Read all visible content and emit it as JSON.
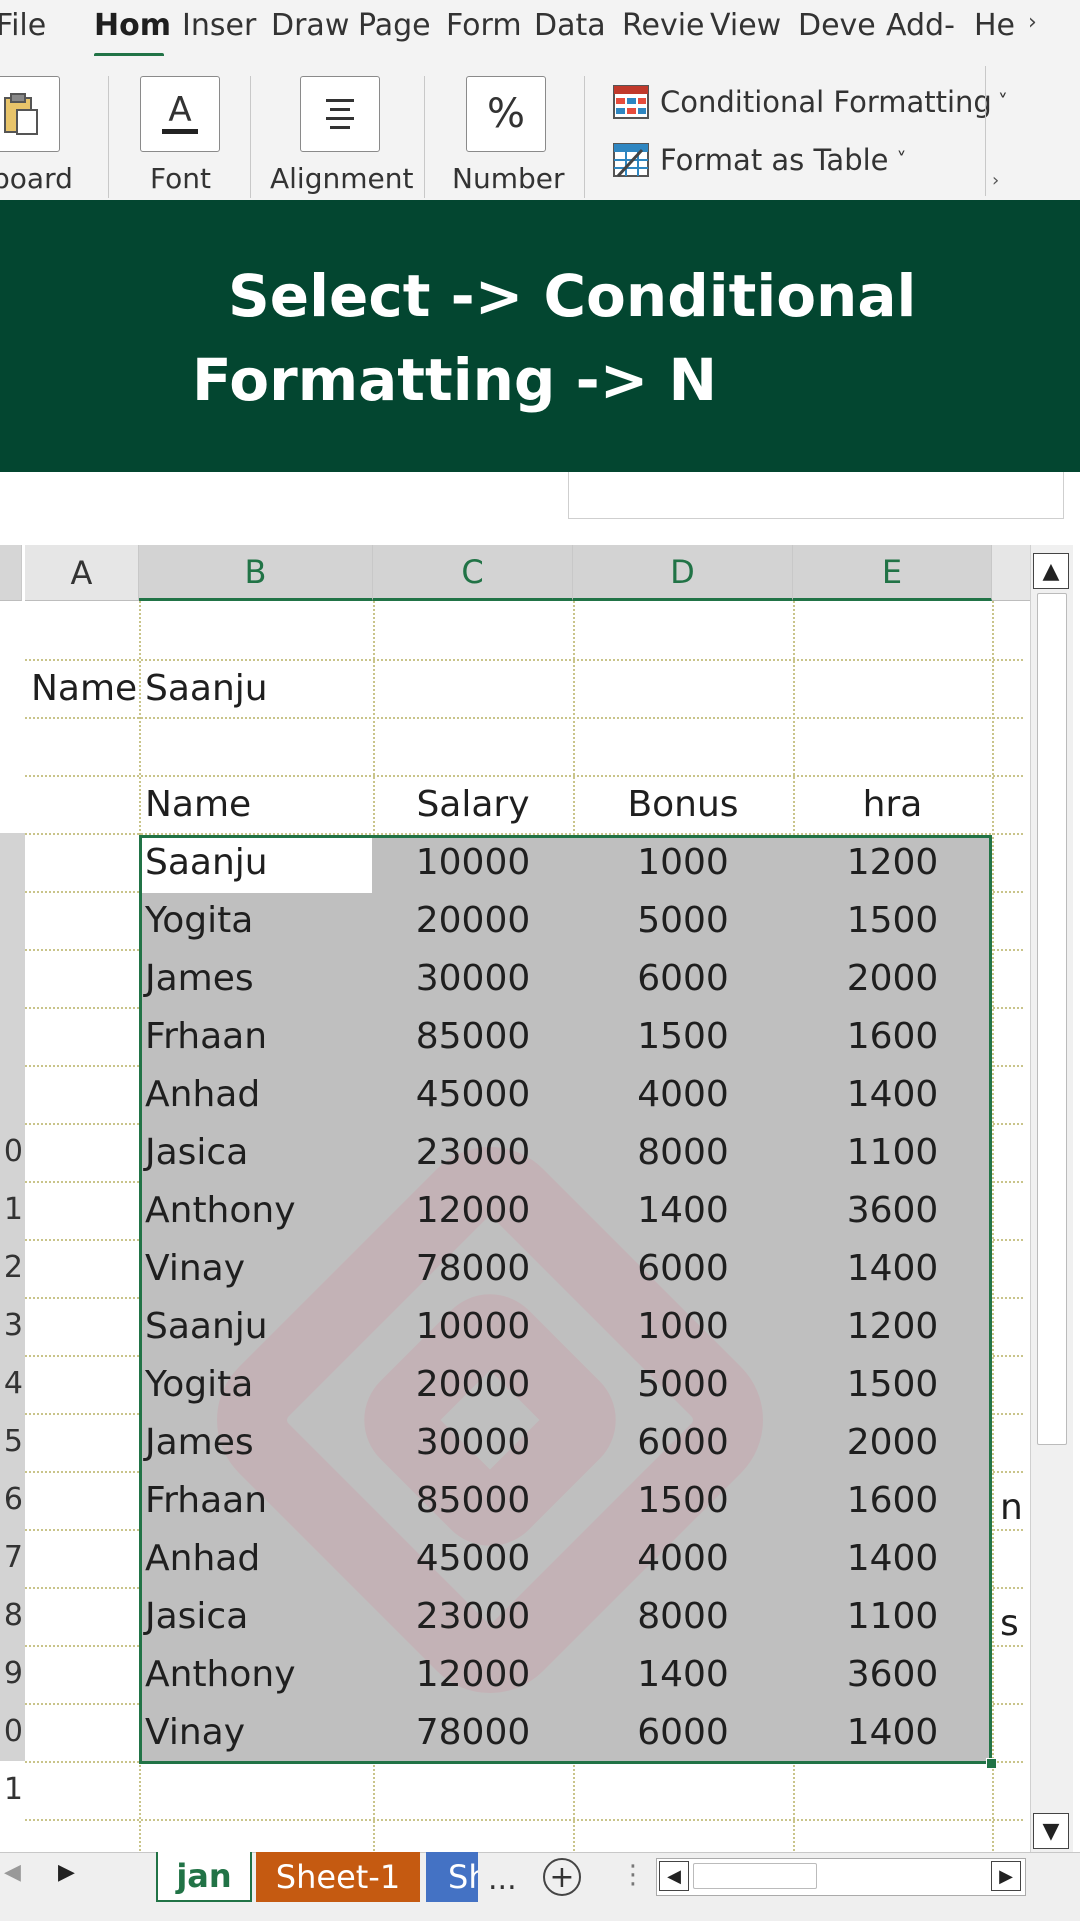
{
  "ribbon": {
    "tabs": [
      "File",
      "Hom",
      "Inser",
      "Draw",
      "Page",
      "Form",
      "Data",
      "Revie",
      "View",
      "Deve",
      "Add-",
      "He"
    ],
    "groups": [
      "board",
      "Font",
      "Alignment",
      "Number"
    ],
    "conditional_formatting": "Conditional Formatting",
    "format_as_table": "Format as Table"
  },
  "banner": {
    "line1": "Select -> Conditional",
    "line2": "Formatting -> N"
  },
  "grid": {
    "columns": [
      "A",
      "B",
      "C",
      "D",
      "E"
    ],
    "row_numbers": [
      "",
      "",
      "",
      "",
      "",
      "",
      "",
      "",
      "",
      "0",
      "1",
      "2",
      "3",
      "4",
      "5",
      "6",
      "7",
      "8",
      "9",
      "0",
      "1",
      ""
    ],
    "label_cell": "Name",
    "label_value": "Saanju",
    "headers": [
      "Name",
      "Salary",
      "Bonus",
      "hra"
    ],
    "rows": [
      [
        "Saanju",
        "10000",
        "1000",
        "1200"
      ],
      [
        "Yogita",
        "20000",
        "5000",
        "1500"
      ],
      [
        "James",
        "30000",
        "6000",
        "2000"
      ],
      [
        "Frhaan",
        "85000",
        "1500",
        "1600"
      ],
      [
        "Anhad",
        "45000",
        "4000",
        "1400"
      ],
      [
        "Jasica",
        "23000",
        "8000",
        "1100"
      ],
      [
        "Anthony",
        "12000",
        "1400",
        "3600"
      ],
      [
        "Vinay",
        "78000",
        "6000",
        "1400"
      ],
      [
        "Saanju",
        "10000",
        "1000",
        "1200"
      ],
      [
        "Yogita",
        "20000",
        "5000",
        "1500"
      ],
      [
        "James",
        "30000",
        "6000",
        "2000"
      ],
      [
        "Frhaan",
        "85000",
        "1500",
        "1600"
      ],
      [
        "Anhad",
        "45000",
        "4000",
        "1400"
      ],
      [
        "Jasica",
        "23000",
        "8000",
        "1100"
      ],
      [
        "Anthony",
        "12000",
        "1400",
        "3600"
      ],
      [
        "Vinay",
        "78000",
        "6000",
        "1400"
      ]
    ],
    "overflow": [
      "n",
      "s"
    ]
  },
  "sheets": {
    "tabs": [
      "jan",
      "Sheet-1",
      "Sh"
    ],
    "more": "...",
    "add": "+"
  },
  "colors": {
    "banner_bg": "#034630",
    "accent": "#217346",
    "selection": "#bfbfbf",
    "sheet1_tab": "#c55a11",
    "sheet2_tab": "#4472c4"
  }
}
